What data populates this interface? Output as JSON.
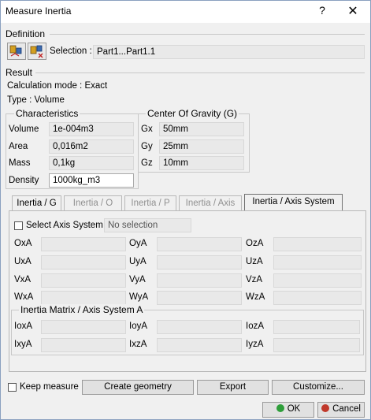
{
  "window": {
    "title": "Measure Inertia",
    "help_icon": "?",
    "close_icon": "✕"
  },
  "definition": {
    "label": "Definition",
    "selection_label": "Selection :",
    "selection_value": "Part1...Part1.1"
  },
  "result": {
    "label": "Result",
    "calc_mode": "Calculation mode :  Exact",
    "type": "Type :  Volume"
  },
  "characteristics": {
    "label": "Characteristics",
    "rows": [
      {
        "name": "Volume",
        "value": "1e-004m3"
      },
      {
        "name": "Area",
        "value": "0,016m2"
      },
      {
        "name": "Mass",
        "value": "0,1kg"
      },
      {
        "name": "Density",
        "value": "1000kg_m3"
      }
    ]
  },
  "cog": {
    "label": "Center Of Gravity (G)",
    "rows": [
      {
        "name": "Gx",
        "value": "50mm"
      },
      {
        "name": "Gy",
        "value": "25mm"
      },
      {
        "name": "Gz",
        "value": "10mm"
      }
    ]
  },
  "tabs": [
    {
      "label": "Inertia / G",
      "state": "normal"
    },
    {
      "label": "Inertia / O",
      "state": "disabled"
    },
    {
      "label": "Inertia / P",
      "state": "disabled"
    },
    {
      "label": "Inertia / Axis",
      "state": "disabled"
    },
    {
      "label": "Inertia / Axis System",
      "state": "active"
    }
  ],
  "axis_panel": {
    "select_axis_label": "Select Axis System",
    "select_axis_value": "No selection",
    "axes": [
      "OxA",
      "OyA",
      "OzA",
      "UxA",
      "UyA",
      "UzA",
      "VxA",
      "VyA",
      "VzA",
      "WxA",
      "WyA",
      "WzA"
    ],
    "matrix_label": "Inertia Matrix / Axis System A",
    "matrix": [
      "IoxA",
      "IoyA",
      "IozA",
      "IxyA",
      "IxzA",
      "IyzA"
    ]
  },
  "bottom": {
    "keep_measure": "Keep measure",
    "create_geometry": "Create geometry",
    "export": "Export",
    "customize": "Customize...",
    "ok": "OK",
    "cancel": "Cancel"
  },
  "colors": {
    "ok_dot": "#2e9e3a",
    "cancel_dot": "#c0392b"
  }
}
